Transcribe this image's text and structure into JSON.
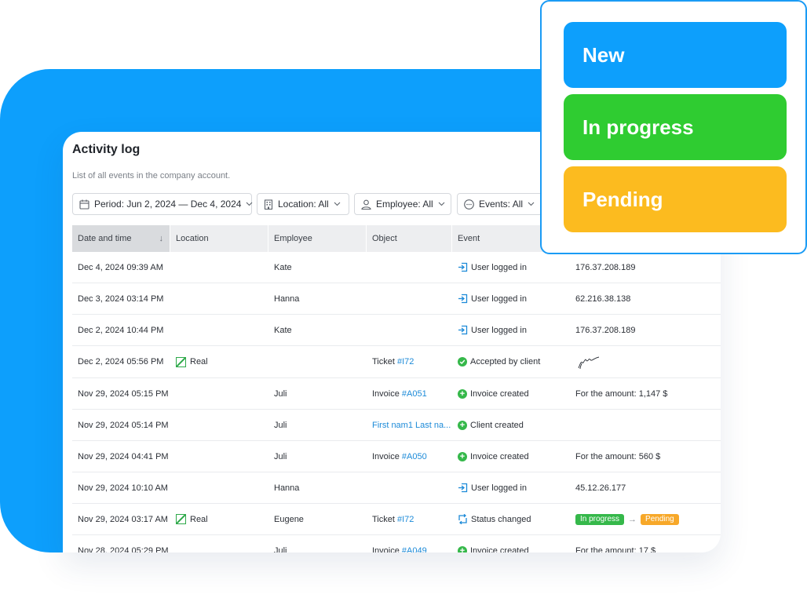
{
  "card": {
    "title": "Activity log",
    "subtitle": "List of all events in the company account."
  },
  "filters": {
    "period": "Period: Jun 2, 2024 — Dec 4, 2024",
    "location": "Location: All",
    "employee": "Employee: All",
    "events": "Events: All"
  },
  "columns": {
    "datetime": "Date and time",
    "location": "Location",
    "employee": "Employee",
    "object": "Object",
    "event": "Event"
  },
  "rows": [
    {
      "datetime": "Dec 4, 2024 09:39 AM",
      "employee": "Kate",
      "event": "User logged in",
      "details": "176.37.208.189"
    },
    {
      "datetime": "Dec 3, 2024 03:14 PM",
      "employee": "Hanna",
      "event": "User logged in",
      "details": "62.216.38.138"
    },
    {
      "datetime": "Dec 2, 2024 10:44 PM",
      "employee": "Kate",
      "event": "User logged in",
      "details": "176.37.208.189"
    },
    {
      "datetime": "Dec 2, 2024 05:56 PM",
      "location": "Real",
      "object_prefix": "Ticket",
      "object_link": "#I72",
      "event": "Accepted by client"
    },
    {
      "datetime": "Nov 29, 2024 05:15 PM",
      "employee": "Juli",
      "object_prefix": "Invoice",
      "object_link": "#A051",
      "event": "Invoice created",
      "details": "For the amount: 1,147 $"
    },
    {
      "datetime": "Nov 29, 2024 05:14 PM",
      "employee": "Juli",
      "object_link": "First nam1 Last na...",
      "event": "Client created"
    },
    {
      "datetime": "Nov 29, 2024 04:41 PM",
      "employee": "Juli",
      "object_prefix": "Invoice",
      "object_link": "#A050",
      "event": "Invoice created",
      "details": "For the amount: 560 $"
    },
    {
      "datetime": "Nov 29, 2024 10:10 AM",
      "employee": "Hanna",
      "event": "User logged in",
      "details": "45.12.26.177"
    },
    {
      "datetime": "Nov 29, 2024 03:17 AM",
      "location": "Real",
      "employee": "Eugene",
      "object_prefix": "Ticket",
      "object_link": "#I72",
      "event": "Status changed",
      "status_from": "In progress",
      "status_to": "Pending"
    },
    {
      "datetime": "Nov 28, 2024 05:29 PM",
      "employee": "Juli",
      "object_prefix": "Invoice",
      "object_link": "#A049",
      "event": "Invoice created",
      "details": "For the amount: 17 $"
    }
  ],
  "status_panel": {
    "items": [
      {
        "label": "New",
        "color": "#0d9ffc"
      },
      {
        "label": "In progress",
        "color": "#2fcc31"
      },
      {
        "label": "Pending",
        "color": "#fcbb1f"
      }
    ]
  },
  "icons": {
    "period": "calendar-icon",
    "location": "building-icon",
    "employee": "person-icon",
    "events": "ellipsis-circle-icon",
    "login": "login-icon",
    "accepted": "check-circle-icon",
    "created": "plus-circle-icon",
    "status": "refresh-icon"
  },
  "colors": {
    "accent_blue": "#0d9ffc",
    "link": "#1c8ad8",
    "success": "#35b84a",
    "warning": "#f7a829"
  }
}
